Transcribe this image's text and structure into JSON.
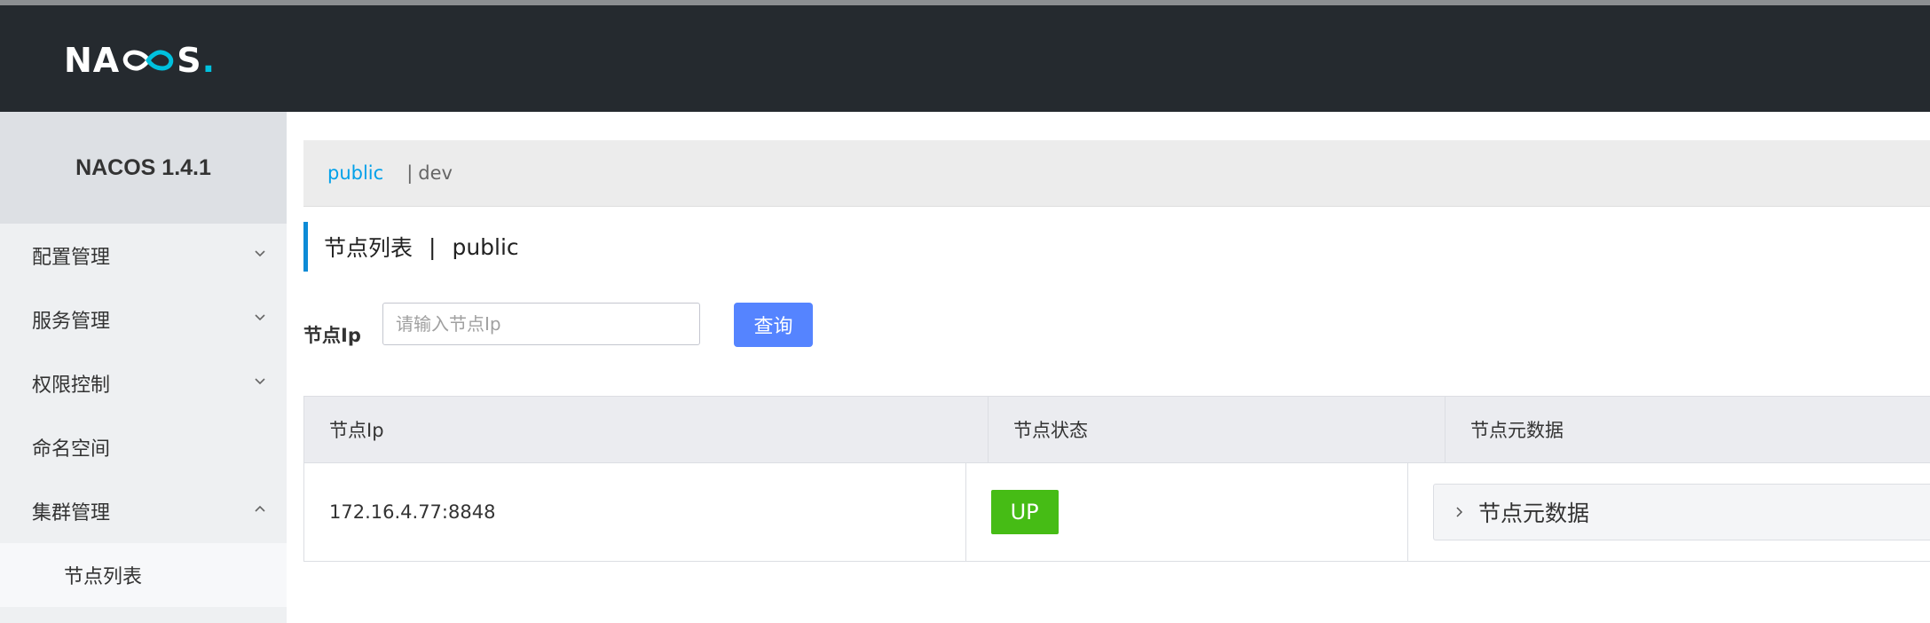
{
  "header": {
    "logo": {
      "left": "NA",
      "right": "S",
      "dot": "."
    }
  },
  "sidebar": {
    "title": "NACOS 1.4.1",
    "items": [
      {
        "label": "配置管理",
        "expanded": false
      },
      {
        "label": "服务管理",
        "expanded": false
      },
      {
        "label": "权限控制",
        "expanded": false
      },
      {
        "label": "命名空间"
      },
      {
        "label": "集群管理",
        "expanded": true
      }
    ],
    "sub_items": [
      {
        "label": "节点列表"
      }
    ]
  },
  "namespace": {
    "active": "public",
    "separator": "|",
    "other": "dev"
  },
  "page": {
    "title": "节点列表",
    "separator": "|",
    "namespace": "public"
  },
  "filter": {
    "label": "节点Ip",
    "placeholder": "请输入节点Ip",
    "button": "查询"
  },
  "table": {
    "columns": [
      "节点Ip",
      "节点状态",
      "节点元数据"
    ],
    "rows": [
      {
        "ip": "172.16.4.77:8848",
        "status": "UP",
        "metadata": "节点元数据"
      }
    ]
  },
  "colors": {
    "header_bg": "#252a2f",
    "accent": "#00c1de",
    "link": "#00a0e9",
    "primary_button": "#5584ff",
    "status_up": "#46bc15"
  }
}
